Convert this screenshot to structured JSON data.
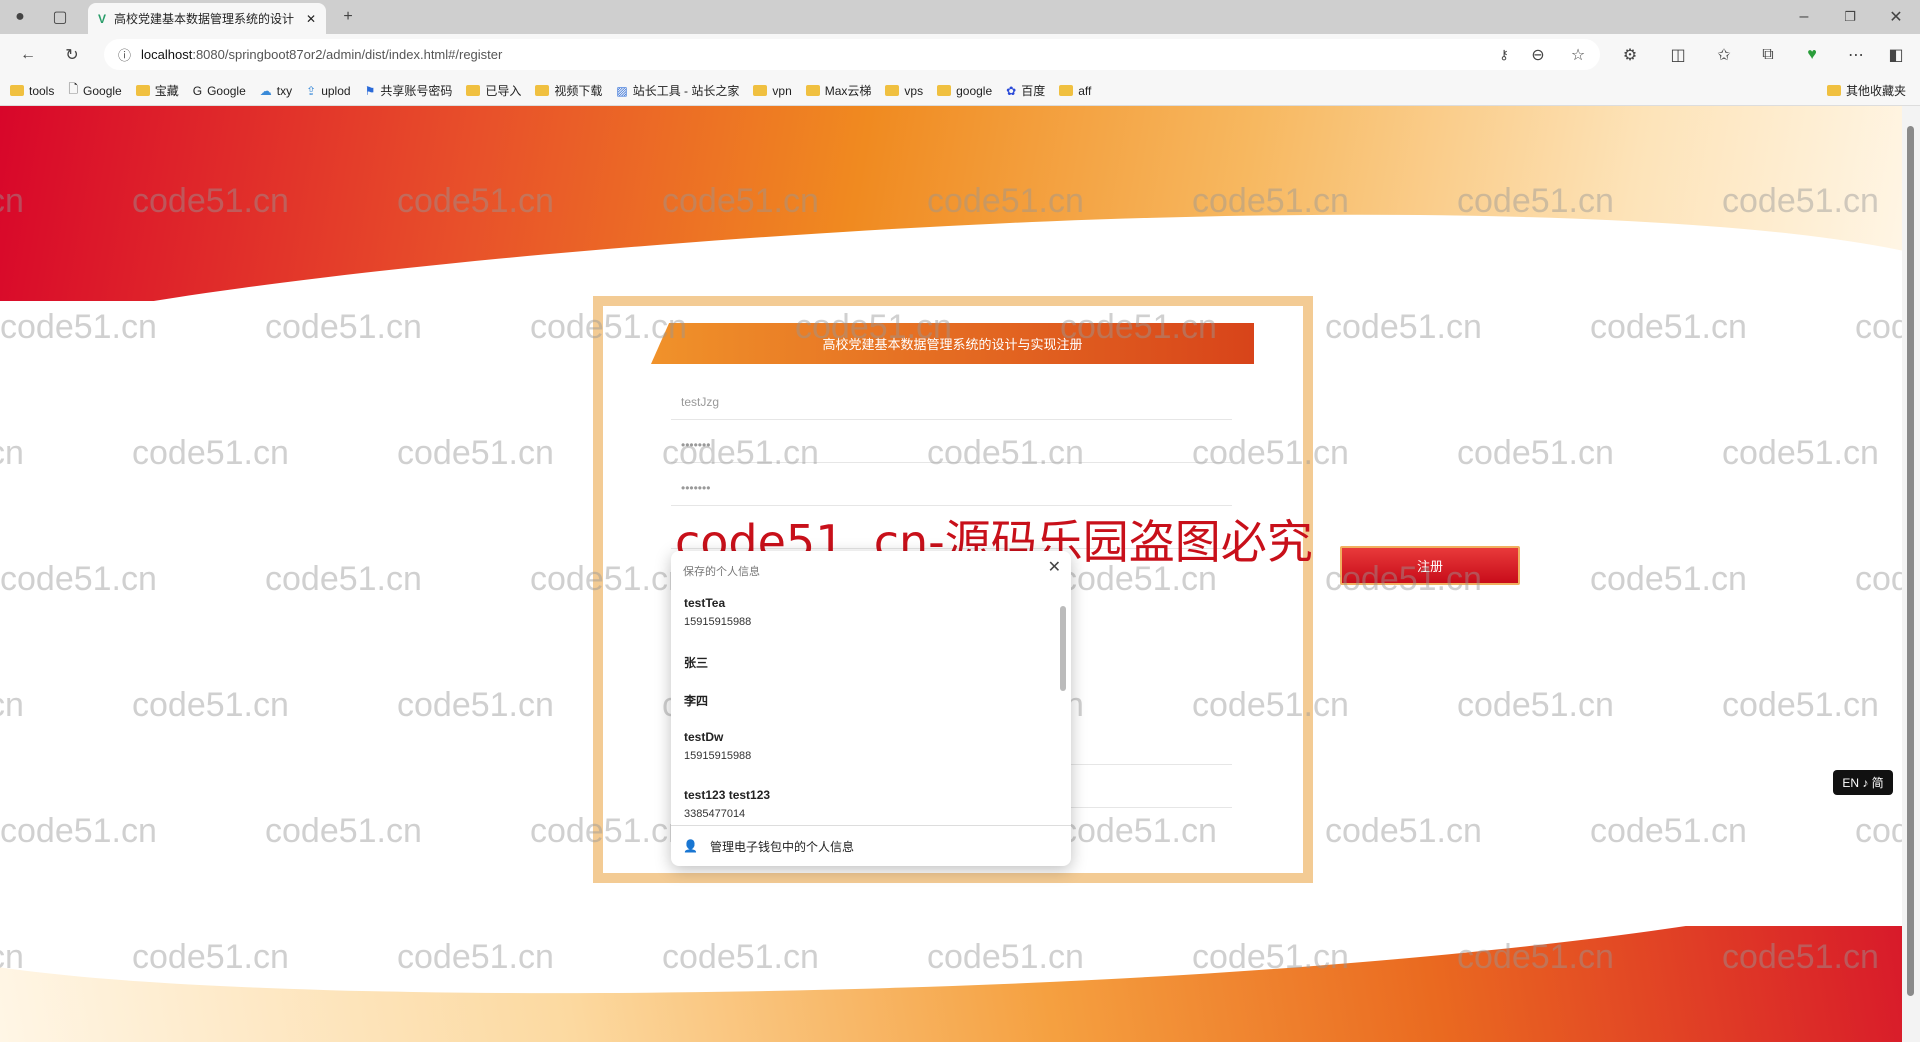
{
  "browser": {
    "tab_title": "高校党建基本数据管理系统的设计",
    "url_host": "localhost",
    "url_rest": ":8080/springboot87or2/admin/dist/index.html#/register",
    "bookmarks": [
      "tools",
      "Google",
      "宝藏",
      "Google",
      "txy",
      "uplod",
      "共享账号密码",
      "已导入",
      "视频下载",
      "站长工具 - 站长之家",
      "vpn",
      "Max云梯",
      "vps",
      "google",
      "百度",
      "aff"
    ],
    "other_bookmarks": "其他收藏夹"
  },
  "form": {
    "title": "高校党建基本数据管理系统的设计与实现注册",
    "fields": [
      {
        "value": "testJzg"
      },
      {
        "value": "•••••••"
      },
      {
        "value": "•••••••"
      },
      {
        "value": ""
      },
      {
        "value": ""
      },
      {
        "value": ""
      }
    ],
    "register_label": "注册"
  },
  "autofill": {
    "header": "保存的个人信息",
    "items": [
      {
        "name": "testTea",
        "sub": "15915915988"
      },
      {
        "name": "张三",
        "sub": ""
      },
      {
        "name": "李四",
        "sub": ""
      },
      {
        "name": "testDw",
        "sub": "15915915988"
      },
      {
        "name": "test123 test123",
        "sub": "3385477014"
      }
    ],
    "footer": "管理电子钱包中的个人信息"
  },
  "watermark": {
    "text": "code51.cn",
    "big": "code51. cn-源码乐园盗图必究"
  },
  "ime": "EN ♪ 简"
}
